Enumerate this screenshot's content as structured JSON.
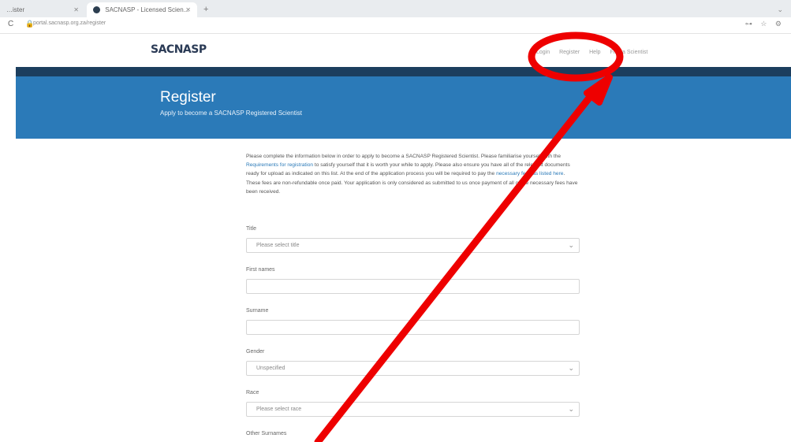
{
  "browser": {
    "tabs": [
      {
        "label": "…ister"
      },
      {
        "label": "SACNASP - Licensed Scien..."
      }
    ],
    "new_tab": "+",
    "window_controls": "⌄",
    "address": "portal.sacnasp.org.za/register",
    "address_lock": "🔒",
    "reload": "C",
    "extra_icons": "⊶ ☆ ⚙"
  },
  "site": {
    "logo": "SACNASP",
    "nav": [
      "Login",
      "Register",
      "Help",
      "Find a Scientist"
    ]
  },
  "banner": {
    "title": "Register",
    "subtitle": "Apply to become a SACNASP Registered Scientist"
  },
  "intro": {
    "part1": "Please complete the information below in order to apply to become a SACNASP Registered Scientist. Please familiarise yourself with the ",
    "link1": "Requirements for registration",
    "part2": " to satisfy yourself that it is worth your while to apply. Please also ensure you have all of the relevant documents ready for upload as indicated on this list. At the end of the application process you will be required to pay the ",
    "link2": "necessary fees as listed here",
    "part3": ". These fees are non-refundable once paid. Your application is only considered as submitted to us once payment of all of the necessary fees have been received."
  },
  "form": {
    "title_label": "Title",
    "title_value": "Please select title",
    "first_names_label": "First names",
    "surname_label": "Surname",
    "gender_label": "Gender",
    "gender_value": "Unspecified",
    "race_label": "Race",
    "race_value": "Please select race",
    "other_surnames_label": "Other Surnames",
    "dropdown_icon": "⌄"
  },
  "annotation_colors": {
    "markup": "#ee0000"
  }
}
